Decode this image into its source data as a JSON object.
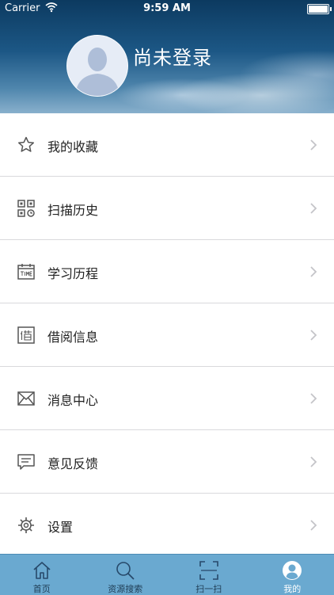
{
  "status_bar": {
    "carrier": "Carrier",
    "time": "9:59 AM"
  },
  "profile": {
    "login_status": "尚未登录"
  },
  "menu": [
    {
      "label": "我的收藏",
      "icon": "star-icon"
    },
    {
      "label": "扫描历史",
      "icon": "qr-code-icon"
    },
    {
      "label": "学习历程",
      "icon": "calendar-time-icon"
    },
    {
      "label": "借阅信息",
      "icon": "borrow-icon"
    },
    {
      "label": "消息中心",
      "icon": "envelope-icon"
    },
    {
      "label": "意见反馈",
      "icon": "comment-icon"
    },
    {
      "label": "设置",
      "icon": "gear-icon"
    }
  ],
  "tabs": [
    {
      "label": "首页",
      "icon": "home-icon"
    },
    {
      "label": "资源搜索",
      "icon": "search-icon"
    },
    {
      "label": "扫一扫",
      "icon": "scan-icon"
    },
    {
      "label": "我的",
      "icon": "user-icon",
      "active": true
    }
  ],
  "colors": {
    "tabbar": "#6aa9d0",
    "active_tab_text": "#ffffff",
    "header": "#1c5785"
  }
}
